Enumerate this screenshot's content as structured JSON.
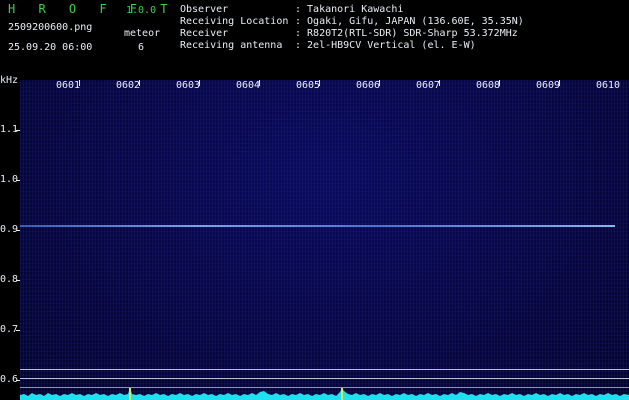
{
  "header": {
    "app_title": "H R O F F T",
    "app_version": "1.0.0",
    "file_name": "2509200600.png",
    "meteor_label": "meteor",
    "datetime": "25.09.20 06:00",
    "meteor_count": "6"
  },
  "info": [
    {
      "key": "Observer",
      "value": ": Takanori Kawachi"
    },
    {
      "key": "Receiving Location",
      "value": ": Ogaki, Gifu, JAPAN (136.60E, 35.35N)"
    },
    {
      "key": "Receiver",
      "value": ": R820T2(RTL-SDR) SDR-Sharp 53.372MHz"
    },
    {
      "key": "Receiving antenna",
      "value": ": 2el-HB9CV Vertical (el. E-W)"
    }
  ],
  "spectrogram": {
    "y_unit": "kHz",
    "time_labels": [
      "0601",
      "0602",
      "0603",
      "0604",
      "0605",
      "0606",
      "0607",
      "0608",
      "0609",
      "0610"
    ],
    "freq_labels": [
      "1.1",
      "1.0",
      "0.9",
      "0.8",
      "0.7",
      "0.6"
    ],
    "signal_khz": 0.9
  },
  "colors": {
    "label_green": "#3ad24a",
    "text_white": "#e9eef5",
    "level_cyan": "#1ee0ee",
    "background_blue": "#06063f"
  }
}
